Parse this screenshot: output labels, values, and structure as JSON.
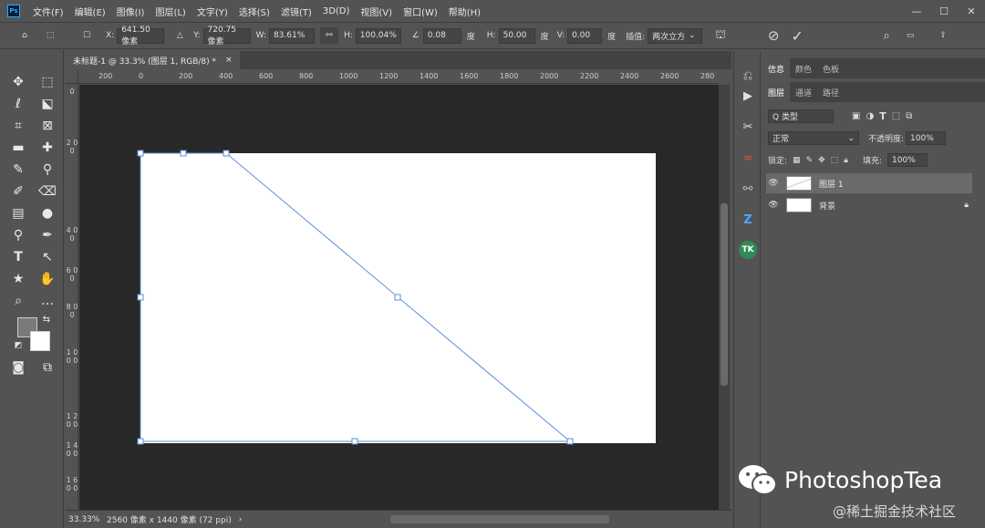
{
  "menu": [
    "文件(F)",
    "编辑(E)",
    "图像(I)",
    "图层(L)",
    "文字(Y)",
    "选择(S)",
    "滤镜(T)",
    "3D(D)",
    "视图(V)",
    "窗口(W)",
    "帮助(H)"
  ],
  "options": {
    "x_label": "X:",
    "x_value": "641.50 像素",
    "y_label": "Y:",
    "y_value": "720.75 像素",
    "w_label": "W:",
    "w_value": "83.61%",
    "h_label": "H:",
    "h_value": "100.04%",
    "angle_value": "0.08",
    "angle_unit": "度",
    "hskew_label": "H:",
    "hskew_value": "50.00",
    "hskew_unit": "度",
    "vskew_label": "V:",
    "vskew_value": "0.00",
    "vskew_unit": "度",
    "interp_label": "插值:",
    "interp_value": "两次立方"
  },
  "document": {
    "tab_label": "未标题-1 @ 33.3% (图层 1, RGB/8) *",
    "close": "×"
  },
  "ruler_top": [
    "200",
    "0",
    "200",
    "400",
    "600",
    "800",
    "1000",
    "1200",
    "1400",
    "1600",
    "1800",
    "2000",
    "2200",
    "2400",
    "2600",
    "280"
  ],
  "ruler_left": [
    "0",
    "2 0 0",
    "4 0 0",
    "6 0 0",
    "8 0 0",
    "1 0 0 0",
    "1 2 0 0",
    "1 4 0 0",
    "1 6 0 0"
  ],
  "status": {
    "zoom": "33.33%",
    "doc_info": "2560 像素 x 1440 像素 (72 ppi)",
    "arrow": "›"
  },
  "panels": {
    "top_tabs": [
      "信息",
      "颜色",
      "色板"
    ],
    "layer_tabs": [
      "图层",
      "通道",
      "路径"
    ],
    "kind_placeholder": "Q 类型",
    "blend_mode": "正常",
    "opacity_label": "不透明度:",
    "opacity_value": "100%",
    "lock_label": "锁定:",
    "fill_label": "填充:",
    "fill_value": "100%",
    "layers": [
      {
        "name": "图层 1"
      },
      {
        "name": "背景"
      }
    ]
  },
  "watermark": {
    "brand": "PhotoshopTea",
    "site": "@稀土掘金技术社区"
  },
  "colors": {
    "bg": "#535353",
    "workspace": "#282828",
    "selection": "#5b8fd6"
  }
}
